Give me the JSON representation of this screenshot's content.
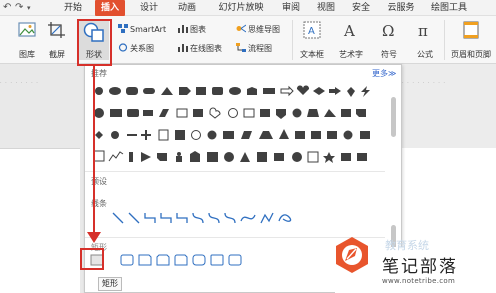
{
  "tabs": [
    {
      "label": "开始"
    },
    {
      "label": "插入"
    },
    {
      "label": "设计"
    },
    {
      "label": "动画"
    },
    {
      "label": "幻灯片放映"
    },
    {
      "label": "审阅"
    },
    {
      "label": "视图"
    },
    {
      "label": "安全"
    },
    {
      "label": "云服务"
    },
    {
      "label": "绘图工具"
    }
  ],
  "ribbon": {
    "picture": "图库",
    "screenshot": "截屏",
    "shapes": "形状",
    "smartart": "SmartArt",
    "chart": "图表",
    "mindmap": "思维导图",
    "relation": "关系图",
    "online_chart": "在线图表",
    "flowchart": "流程图",
    "textbox": "文本框",
    "art_text": "艺术字",
    "symbol": "符号",
    "formula": "公式",
    "header_footer": "页眉和页脚"
  },
  "panel": {
    "recommended": "推荐",
    "more": "更多≫",
    "preset": "预设",
    "lines": "线条",
    "rect_section": "矩形"
  },
  "tooltip": "矩形",
  "watermark": {
    "title": "笔记部落",
    "site": "www.notetribe.com",
    "faint": "教育系统"
  },
  "colors": {
    "active_tab": "#e2502f",
    "highlight": "#d6302a",
    "shape_blue": "#2f6fc0"
  }
}
